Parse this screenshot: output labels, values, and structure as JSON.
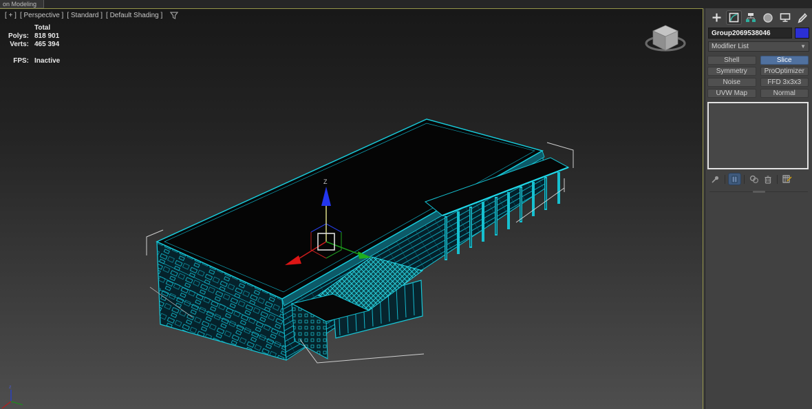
{
  "ribbon": {
    "tab_fragment": "on Modeling"
  },
  "viewport": {
    "label_general": "[ + ]",
    "label_pov": "[ Perspective ]",
    "label_type": "[ Standard ]",
    "label_shading": "[ Default Shading ]",
    "stats": {
      "total_label": "Total",
      "polys_label": "Polys:",
      "polys_value": "818 901",
      "verts_label": "Verts:",
      "verts_value": "465 394",
      "fps_label": "FPS:",
      "fps_value": "Inactive"
    },
    "gizmo": {
      "z_label": "Z"
    },
    "colors": {
      "wireframe": "#18ccdc",
      "selection_bracket": "#d0d0d0",
      "axis_x": "#d02020",
      "axis_y": "#20a020",
      "axis_z": "#2840e8",
      "active_border": "#96964a"
    }
  },
  "command_panel": {
    "tabs": [
      {
        "name": "create"
      },
      {
        "name": "modify",
        "active": true
      },
      {
        "name": "hierarchy"
      },
      {
        "name": "motion"
      },
      {
        "name": "display"
      },
      {
        "name": "utilities"
      }
    ],
    "object_name": "Group2069538046",
    "object_color": "#2b2fd4",
    "modifier_list_label": "Modifier List",
    "dropdown_arrow": "▼",
    "modifier_buttons": [
      {
        "label": "Shell",
        "active": false
      },
      {
        "label": "Slice",
        "active": true
      },
      {
        "label": "Symmetry",
        "active": false
      },
      {
        "label": "ProOptimizer",
        "active": false
      },
      {
        "label": "Noise",
        "active": false
      },
      {
        "label": "FFD 3x3x3",
        "active": false
      },
      {
        "label": "UVW Map",
        "active": false
      },
      {
        "label": "Normal",
        "active": false
      }
    ],
    "accent_color": "#50719f",
    "stack_tools": [
      "pin-stack",
      "show-end-result",
      "make-unique",
      "remove-modifier",
      "configure-modifier-sets"
    ]
  }
}
